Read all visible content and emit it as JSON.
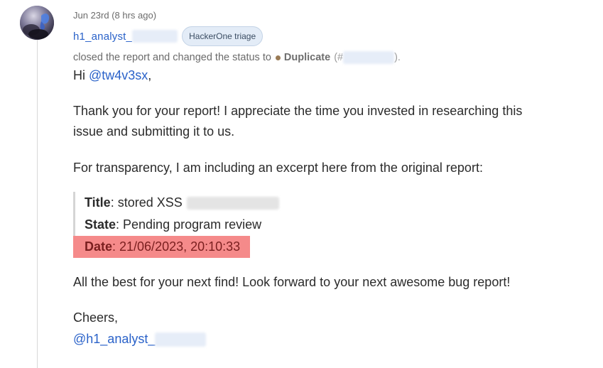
{
  "comment": {
    "timestamp": "Jun 23rd (8 hrs ago)",
    "author": "h1_analyst_",
    "author_badge": "HackerOne triage",
    "action_text": "closed the report and changed the status to",
    "status": "Duplicate",
    "status_prefix": "(#",
    "status_suffix": ").",
    "status_color": "#9a7b56",
    "greeting_prefix": "Hi ",
    "greeting_mention": "@tw4v3sx",
    "greeting_suffix": ",",
    "paragraph1_line1": "Thank you for your report! I appreciate the time you invested in researching this",
    "paragraph1_line2": "issue and submitting it to us.",
    "paragraph2": "For transparency, I am including an excerpt here from the original report:",
    "quote": {
      "title_key": "Title",
      "title_value": ": stored XSS",
      "state_key": "State",
      "state_value": ": Pending program review",
      "date_key": "Date",
      "date_value": ": 21/06/2023, 20:10:33",
      "highlight_color": "#f58a8a"
    },
    "closing_line": "All the best for your next find! Look forward to your next awesome bug report!",
    "signoff": "Cheers,",
    "signature": "@h1_analyst_",
    "link_color": "#2a62c9"
  }
}
